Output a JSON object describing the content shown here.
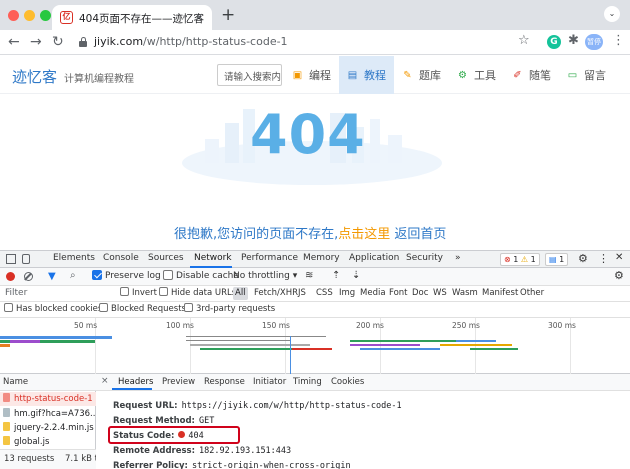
{
  "browser": {
    "tab_title": "404页面不存在——迹忆客",
    "tab_favicon": "亿",
    "tab_close": "×",
    "new_tab": "+",
    "tabbar_menu": "⌄",
    "url_host": "jiyik.com",
    "url_path": "/w/http/http-status-code-1",
    "avatar_label": "暂停",
    "extension_g": "G"
  },
  "site": {
    "logo": "迹忆客",
    "slogan": "计算机编程教程",
    "search_placeholder": "请输入搜索内",
    "nav": [
      {
        "label": "编程",
        "icon": "code-icon",
        "color": "#f39800"
      },
      {
        "label": "教程",
        "icon": "book-icon",
        "color": "#2e78c7"
      },
      {
        "label": "题库",
        "icon": "quiz-icon",
        "color": "#f39800"
      },
      {
        "label": "工具",
        "icon": "tool-icon",
        "color": "#28a745"
      },
      {
        "label": "随笔",
        "icon": "pen-icon",
        "color": "#d93025"
      },
      {
        "label": "留言",
        "icon": "message-icon",
        "color": "#28a745"
      }
    ],
    "hero_code": "404",
    "hero_msg_part1": "很抱歉,您访问的页面不存在,",
    "hero_link": "点击这里",
    "hero_msg_part2": " 返回首页"
  },
  "devtools": {
    "tabs": [
      "Elements",
      "Console",
      "Sources",
      "Network",
      "Performance",
      "Memory",
      "Application",
      "Security"
    ],
    "active_tab": "Network",
    "more_tabs": "»",
    "badges": {
      "errors": "1",
      "warnings": "1",
      "info": "1"
    },
    "toolbar": {
      "preserve_log": "Preserve log",
      "disable_cache": "Disable cache",
      "throttling": "No throttling"
    },
    "filter": {
      "label": "Filter",
      "invert": "Invert",
      "hide_data_urls": "Hide data URLs",
      "types": [
        "All",
        "Fetch/XHR",
        "JS",
        "CSS",
        "Img",
        "Media",
        "Font",
        "Doc",
        "WS",
        "Wasm",
        "Manifest",
        "Other"
      ]
    },
    "row4": {
      "blocked_cookies": "Has blocked cookies",
      "blocked_requests": "Blocked Requests",
      "third_party": "3rd-party requests"
    },
    "timeline_ticks": [
      "50 ms",
      "100 ms",
      "150 ms",
      "200 ms",
      "250 ms",
      "300 ms"
    ],
    "requests_header": "Name",
    "requests": [
      {
        "name": "http-status-code-1",
        "type": "doc",
        "selected": true
      },
      {
        "name": "hm.gif?hca=A736...",
        "type": "img",
        "selected": false
      },
      {
        "name": "jquery-2.2.4.min.js",
        "type": "js",
        "selected": false
      },
      {
        "name": "global.js",
        "type": "js",
        "selected": false
      }
    ],
    "footer": {
      "requests": "13 requests",
      "transferred": "7.1 kB tr"
    },
    "detail_close": "×",
    "detail_tabs": [
      "Headers",
      "Preview",
      "Response",
      "Initiator",
      "Timing",
      "Cookies"
    ],
    "detail_active": "Headers",
    "general": {
      "request_url_key": "Request URL:",
      "request_url": "https://jiyik.com/w/http/http-status-code-1",
      "request_method_key": "Request Method:",
      "request_method": "GET",
      "status_code_key": "Status Code:",
      "status_code": "404",
      "remote_address_key": "Remote Address:",
      "remote_address": "182.92.193.151:443",
      "referrer_policy_key": "Referrer Policy:",
      "referrer_policy": "strict-origin-when-cross-origin"
    }
  }
}
